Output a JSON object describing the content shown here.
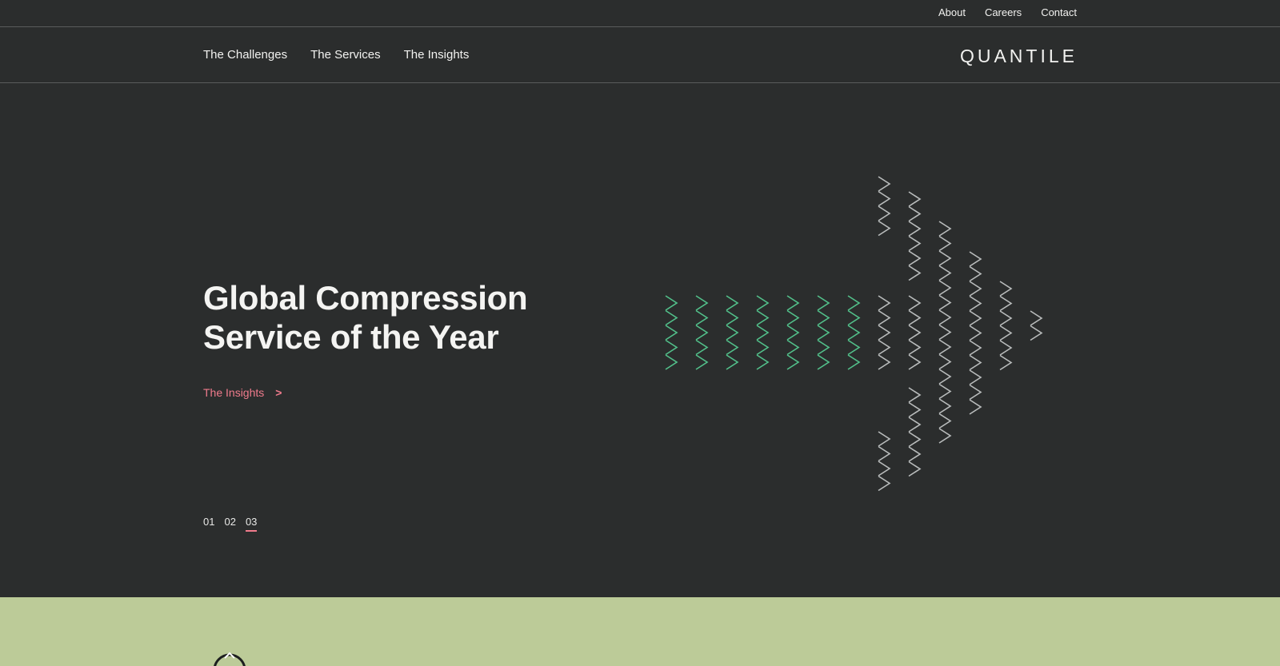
{
  "topbar": {
    "links": [
      "About",
      "Careers",
      "Contact"
    ]
  },
  "nav": {
    "items": [
      "The Challenges",
      "The Services",
      "The Insights"
    ],
    "logo": "QUANTILE"
  },
  "hero": {
    "title_line1": "Global Compression",
    "title_line2": "Service of the Year",
    "cta_label": "The Insights",
    "cta_chevron": ">",
    "pager": [
      "01",
      "02",
      "03"
    ],
    "active_slide": "03"
  },
  "colors": {
    "background": "#2b2d2d",
    "accent": "#f07b8c",
    "green": "#52c08a",
    "grey_chevron": "#b9bcbc",
    "lower_band": "#bccb98"
  },
  "icons": {
    "arrow_art": "chevron-arrow-graphic",
    "emblem": "emblem-icon"
  }
}
